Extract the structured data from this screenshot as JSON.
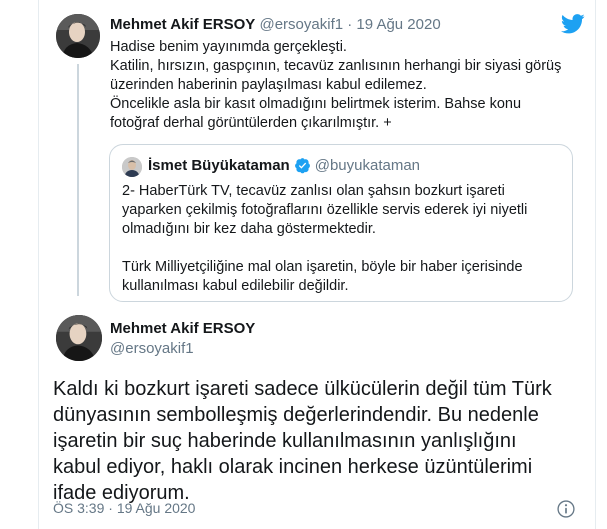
{
  "parent_tweet": {
    "author_name": "Mehmet Akif ERSOY",
    "handle": "@ersoyakif1",
    "separator": "·",
    "date": "19 Ağu 2020",
    "lines": [
      "Hadise benim yayınımda gerçekleşti.",
      "Katilin, hırsızın, gaspçının, tecavüz zanlısının herhangi bir siyasi görüş üzerinden haberinin paylaşılması kabul edilemez.",
      "Öncelikle asla bir kasıt olmadığını belirtmek isterim. Bahse konu fotoğraf derhal görüntülerden çıkarılmıştır. +"
    ]
  },
  "quoted_tweet": {
    "author_name": "İsmet Büyükataman",
    "handle": "@buyukataman",
    "paragraph_1": "2- HaberTürk TV, tecavüz zanlısı olan şahsın bozkurt işareti yaparken çekilmiş fotoğraflarını özellikle servis ederek iyi niyetli olmadığını bir kez daha göstermektedir.",
    "paragraph_2": "Türk Milliyetçiliğine mal olan işaretin, böyle bir haber içerisinde kullanılması kabul edilebilir değildir."
  },
  "main_tweet": {
    "author_name": "Mehmet Akif ERSOY",
    "handle": "@ersoyakif1",
    "text": "Kaldı ki bozkurt işareti sadece ülkücülerin değil tüm Türk dünyasının sembolleşmiş değerlerindendir. Bu nedenle işaretin bir suç haberinde kullanılmasının yanlışlığını kabul ediyor, haklı olarak incinen herkese üzüntülerimi ifade ediyorum.",
    "time": "ÖS 3:39",
    "separator": "·",
    "date": "19 Ağu 2020"
  },
  "icons": {
    "brand": "twitter-bird-icon",
    "verified": "verified-badge-icon",
    "info": "info-icon"
  },
  "colors": {
    "twitter_blue": "#1da1f2",
    "muted_text": "#657786",
    "border": "#ccd6dd"
  }
}
